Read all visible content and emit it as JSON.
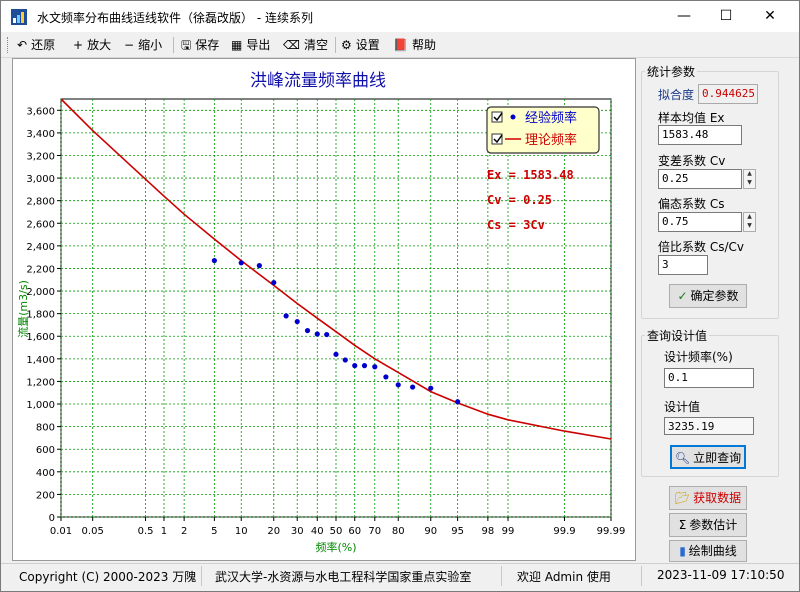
{
  "window": {
    "title": "水文频率分布曲线适线软件（徐磊改版） - 连续系列",
    "minimize_glyph": "—",
    "maximize_glyph": "☐",
    "close_glyph": "✕"
  },
  "toolbar": {
    "items": [
      {
        "label": "还原",
        "icon": "undo-icon",
        "glyph": "↶"
      },
      {
        "label": "放大",
        "icon": "plus-icon",
        "glyph": "+"
      },
      {
        "label": "缩小",
        "icon": "minus-icon",
        "glyph": "−"
      },
      {
        "label": "保存",
        "icon": "floppy-icon",
        "glyph": "🖫"
      },
      {
        "label": "导出",
        "icon": "export-icon",
        "glyph": "▦"
      },
      {
        "label": "清空",
        "icon": "eraser-icon",
        "glyph": "⌫"
      },
      {
        "label": "设置",
        "icon": "settings-icon",
        "glyph": "⚙"
      },
      {
        "label": "帮助",
        "icon": "help-book-icon",
        "glyph": "📕"
      }
    ]
  },
  "chart_data": {
    "type": "scatter",
    "title": "洪峰流量频率曲线",
    "xlabel": "频率(%)",
    "ylabel": "流量(m3/s)",
    "x_scale": "normal-probability",
    "x_tick_labels": [
      "0.01",
      "0.05",
      "0.5",
      "1",
      "2",
      "5",
      "10",
      "20",
      "30",
      "40",
      "50",
      "60",
      "70",
      "80",
      "90",
      "95",
      "98",
      "99",
      "99.9",
      "99.99"
    ],
    "x_ticks": [
      0.01,
      0.05,
      0.5,
      1,
      2,
      5,
      10,
      20,
      30,
      40,
      50,
      60,
      70,
      80,
      90,
      95,
      98,
      99,
      99.9,
      99.99
    ],
    "ylim": [
      0,
      3700
    ],
    "y_ticks": [
      0,
      200,
      400,
      600,
      800,
      1000,
      1200,
      1400,
      1600,
      1800,
      2000,
      2200,
      2400,
      2600,
      2800,
      3000,
      3200,
      3400,
      3600
    ],
    "y_tick_labels": [
      "0",
      "200",
      "400",
      "600",
      "800",
      "1,000",
      "1,200",
      "1,400",
      "1,600",
      "1,800",
      "2,000",
      "2,200",
      "2,400",
      "2,600",
      "2,800",
      "3,000",
      "3,200",
      "3,400",
      "3,600"
    ],
    "grid": true,
    "grid_color": "#009900",
    "curve_color": "#cc0000",
    "point_color": "#0000cc",
    "series": [
      {
        "name": "经验频率",
        "kind": "points",
        "x": [
          5,
          10,
          15,
          20,
          25,
          30,
          35,
          40,
          45,
          50,
          55,
          60,
          65,
          70,
          75,
          80,
          85,
          90,
          95
        ],
        "y": [
          2270,
          2250,
          2225,
          2075,
          1780,
          1730,
          1650,
          1620,
          1615,
          1440,
          1390,
          1340,
          1340,
          1330,
          1240,
          1170,
          1150,
          1140,
          1020
        ]
      },
      {
        "name": "理论频率",
        "kind": "curve",
        "x": [
          0.01,
          0.05,
          0.1,
          0.5,
          1,
          2,
          5,
          10,
          20,
          30,
          40,
          50,
          60,
          70,
          80,
          90,
          95,
          98,
          99,
          99.9,
          99.99
        ],
        "y": [
          3700,
          3420,
          3300,
          2990,
          2840,
          2680,
          2460,
          2270,
          2050,
          1890,
          1760,
          1640,
          1520,
          1400,
          1280,
          1110,
          1010,
          910,
          860,
          760,
          690
        ]
      }
    ],
    "legend": {
      "placement": "top-right",
      "items": [
        "经验频率",
        "理论频率"
      ]
    },
    "annotations": [
      "Ex = 1583.48",
      "Cv = 0.25",
      "Cs = 3Cv"
    ]
  },
  "panel": {
    "stats_title": "统计参数",
    "fit_label": "拟合度",
    "fit_value": "0.944625",
    "mean_label": "样本均值 Ex",
    "mean_value": "1583.48",
    "cv_label": "变差系数 Cv",
    "cv_value": "0.25",
    "cs_label": "偏态系数 Cs",
    "cs_value": "0.75",
    "ratio_label": "倍比系数 Cs/Cv",
    "ratio_value": "3",
    "confirm_button": "确定参数",
    "query_title": "查询设计值",
    "design_freq_label": "设计频率(%)",
    "design_freq_value": "0.1",
    "design_value_label": "设计值",
    "design_value": "3235.19",
    "query_button": "立即查询",
    "get_data_button": "获取数据",
    "estimate_button": "参数估计",
    "draw_button": "绘制曲线"
  },
  "statusbar": {
    "copyright": "Copyright (C) 2000-2023 万隗",
    "org": "武汉大学-水资源与水电工程科学国家重点实验室",
    "welcome": "欢迎 Admin 使用",
    "datetime": "2023-11-09 17:10:50"
  }
}
